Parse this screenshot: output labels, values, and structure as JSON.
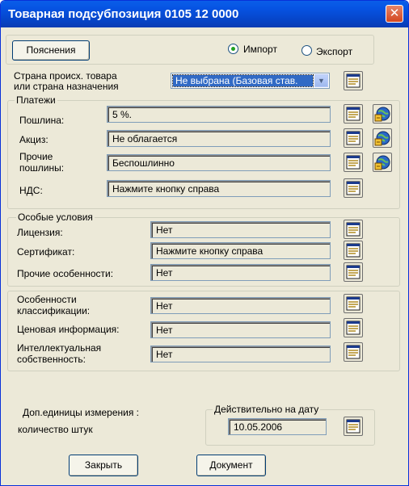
{
  "window": {
    "title": "Товарная подсубпозиция 0105 12 0000",
    "close_glyph": "✕"
  },
  "top": {
    "explanations_button": "Пояснения",
    "direction": {
      "import_label": "Импорт",
      "export_label": "Экспорт",
      "selected": "Импорт"
    },
    "country_label_line1": "Страна происх. товара",
    "country_label_line2": "или страна назначения",
    "country_value": "Не выбрана (Базовая став.",
    "dropdown_glyph": "▼"
  },
  "payments": {
    "legend": "Платежи",
    "duty": {
      "label": "Пошлина:",
      "value": "5 %."
    },
    "excise": {
      "label": "Акциз:",
      "value": "Не облагается"
    },
    "other": {
      "label_line1": "Прочие",
      "label_line2": "пошлины:",
      "value": "Беспошлинно"
    },
    "vat": {
      "label": "НДС:",
      "value": "Нажмите кнопку справа"
    }
  },
  "special": {
    "legend": "Особые условия",
    "license": {
      "label": "Лицензия:",
      "value": "Нет"
    },
    "certificate": {
      "label": "Сертификат:",
      "value": "Нажмите кнопку справа"
    },
    "other_features": {
      "label": "Прочие особенности:",
      "value": "Нет"
    }
  },
  "classification": {
    "features": {
      "label_line1": "Особенности",
      "label_line2": "классификации:",
      "value": "Нет"
    },
    "price_info": {
      "label": "Ценовая информация:",
      "value": "Нет"
    },
    "intellectual": {
      "label_line1": "Интеллектуальная",
      "label_line2": "собственность:",
      "value": "Нет"
    }
  },
  "bottom": {
    "units_label": "Доп.единицы измерения :",
    "units_value": "количество штук",
    "valid_legend": "Действительно на дату",
    "valid_date": "10.05.2006",
    "close_button": "Закрыть",
    "document_button": "Документ"
  },
  "icons": {
    "detail": "document-list-icon",
    "calculator": "globe-calculator-icon"
  },
  "colors": {
    "titlebar": "#0653e2",
    "dialog_bg": "#ece9d8",
    "selection": "#316ac5",
    "close_button": "#d4461f"
  }
}
